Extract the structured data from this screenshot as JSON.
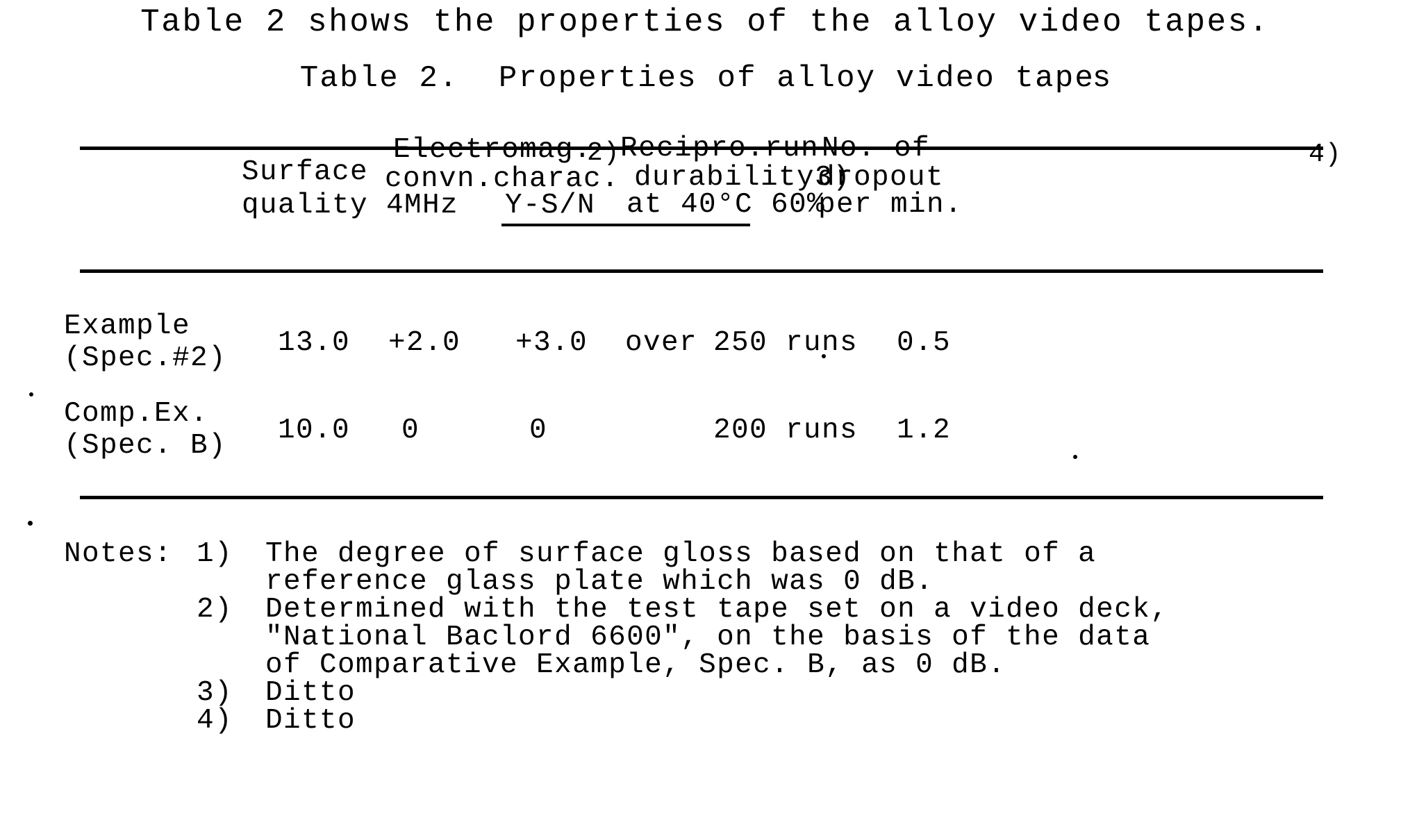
{
  "intro": {
    "text": "Table 2 shows the properties of the alloy video tapes."
  },
  "caption": {
    "prefix": "Table 2.  Properties of alloy video tap",
    "tail": "es"
  },
  "table": {
    "headers": {
      "row_label": "",
      "surface": {
        "line1": "Surface",
        "line2": "quality"
      },
      "electromag": {
        "line1": "Electromag.",
        "line2": "convn.charac.",
        "footnote": "2)",
        "sub1": "4MHz",
        "sub2": "Y-S/N"
      },
      "durability": {
        "line1": "Recipro.run",
        "line2": "durability3)",
        "line3": "at 40°C 60%"
      },
      "dropout": {
        "line1": "No. of",
        "line2": "dropout",
        "footnote": "4)",
        "line3": "per min."
      }
    },
    "rows": [
      {
        "label_line1": "Example",
        "label_line2": "(Spec.#2)",
        "surface_quality": "13.0",
        "em_4mhz": "+2.0",
        "em_ysn": "+3.0",
        "durability_prefix": "over",
        "durability": "250 runs",
        "dropout": "0.5"
      },
      {
        "label_line1": "Comp.Ex.",
        "label_line2": "(Spec. B)",
        "surface_quality": "10.0",
        "em_4mhz": "0",
        "em_ysn": "0",
        "durability_prefix": "",
        "durability": "200 runs",
        "dropout": "1.2"
      }
    ]
  },
  "notes": {
    "label": "Notes:",
    "items": [
      {
        "number": "1)",
        "lines": [
          "The degree of surface gloss based on that of a",
          "reference glass plate which was 0 dB."
        ]
      },
      {
        "number": "2)",
        "lines": [
          "Determined with the test tape set on a video deck,",
          "\"National Baclord 6600\", on the basis of the data",
          "of Comparative Example, Spec. B, as 0 dB."
        ]
      },
      {
        "number": "3)",
        "lines": [
          "Ditto"
        ]
      },
      {
        "number": "4)",
        "lines": [
          "Ditto"
        ]
      }
    ]
  },
  "colors": {
    "ink": "#000000",
    "paper": "#ffffff"
  }
}
